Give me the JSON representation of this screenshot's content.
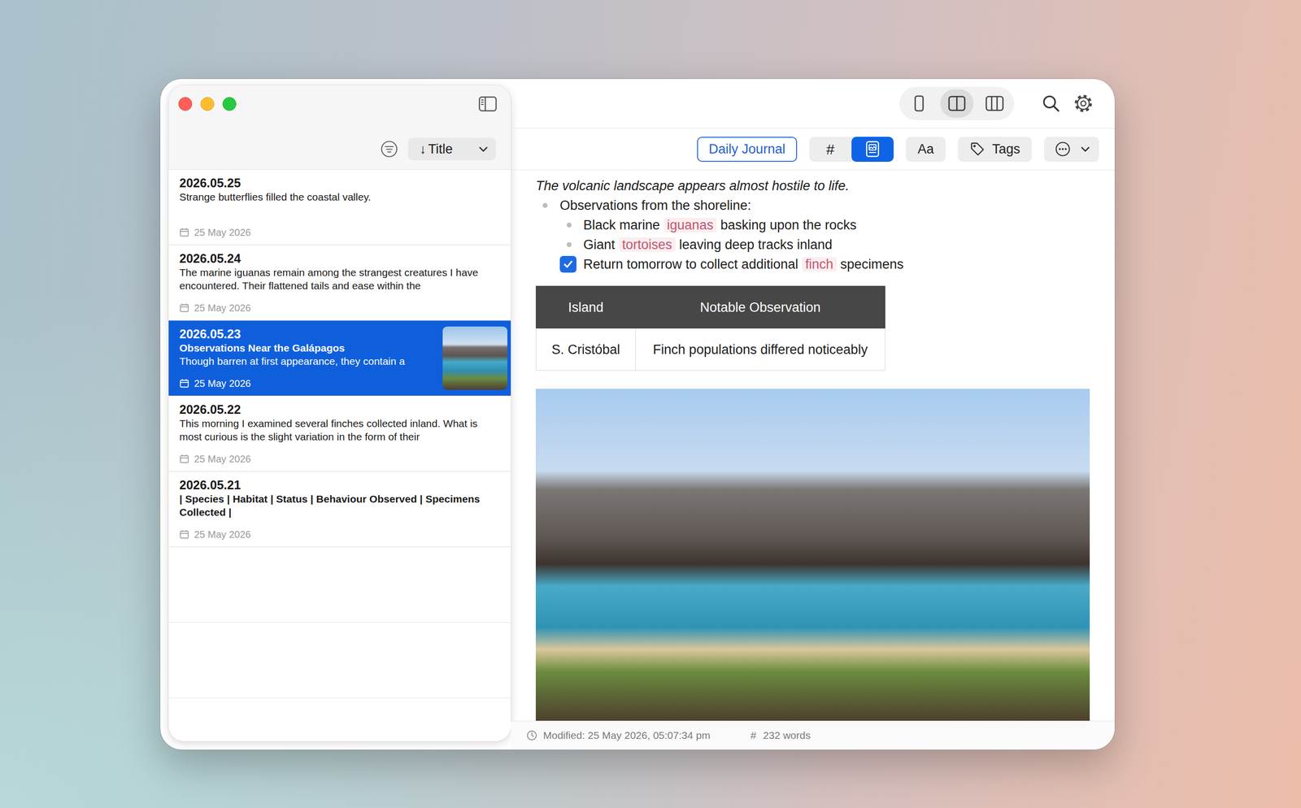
{
  "sidebar": {
    "sort": {
      "arrow": "↓",
      "label": "Title"
    },
    "notes": [
      {
        "title": "2026.05.25",
        "excerpt": "Strange butterflies filled the coastal valley.",
        "date": "25 May 2026",
        "kind": "plain",
        "selected": false,
        "thumbnail": false
      },
      {
        "title": "2026.05.24",
        "excerpt": "The marine iguanas remain among the strangest creatures I have encountered. Their flattened tails and ease within the",
        "date": "25 May 2026",
        "kind": "plain",
        "selected": false,
        "thumbnail": false
      },
      {
        "title": "2026.05.23",
        "heading": "Observations Near the Galápagos",
        "excerpt": "Though barren at first appearance, they contain a",
        "date": "25 May 2026",
        "kind": "plain",
        "selected": true,
        "thumbnail": true
      },
      {
        "title": "2026.05.22",
        "excerpt": "This morning I examined several finches collected inland. What is most curious is the slight variation in the form of their",
        "date": "25 May 2026",
        "kind": "plain",
        "selected": false,
        "thumbnail": false
      },
      {
        "title": "2026.05.21",
        "excerpt": "| Species | Habitat | Status | Behaviour Observed | Specimens Collected |",
        "date": "25 May 2026",
        "kind": "table",
        "selected": false,
        "thumbnail": false
      }
    ]
  },
  "view_modes": [
    {
      "kind": "single",
      "selected": false
    },
    {
      "kind": "split",
      "selected": true
    },
    {
      "kind": "triple",
      "selected": false
    }
  ],
  "editor_toolbar": {
    "journal": "Daily Journal",
    "format_group": [
      {
        "kind": "text",
        "label": "#",
        "selected": false
      },
      {
        "kind": "image",
        "selected": true
      }
    ],
    "font": "Aa",
    "tags": "Tags"
  },
  "content": {
    "blocks": [
      {
        "kind": "italic",
        "segments": [
          {
            "text": "The volcanic landscape appears almost hostile to life.",
            "tag": false
          }
        ]
      },
      {
        "kind": "bullet",
        "segments": [
          {
            "text": "Observations from the shoreline:",
            "tag": false
          }
        ]
      },
      {
        "kind": "sub-bullet",
        "segments": [
          {
            "text": "Black marine ",
            "tag": false
          },
          {
            "text": "iguanas",
            "tag": true
          },
          {
            "text": " basking upon the rocks",
            "tag": false
          }
        ]
      },
      {
        "kind": "sub-bullet",
        "segments": [
          {
            "text": "Giant ",
            "tag": false
          },
          {
            "text": "tortoises",
            "tag": true
          },
          {
            "text": " leaving deep tracks inland",
            "tag": false
          }
        ]
      },
      {
        "kind": "task",
        "checked": true,
        "segments": [
          {
            "text": "Return tomorrow to collect additional ",
            "tag": false
          },
          {
            "text": "finch",
            "tag": true
          },
          {
            "text": " specimens",
            "tag": false
          }
        ]
      }
    ],
    "table": {
      "columns": [
        "Island",
        "Notable Observation"
      ],
      "rows": [
        [
          "S. Cristóbal",
          "Finch populations differed noticeably"
        ]
      ]
    }
  },
  "status_bar": {
    "modified": "Modified: 25 May 2026, 05:07:34 pm",
    "words_icon": "#",
    "words": "232 words"
  }
}
